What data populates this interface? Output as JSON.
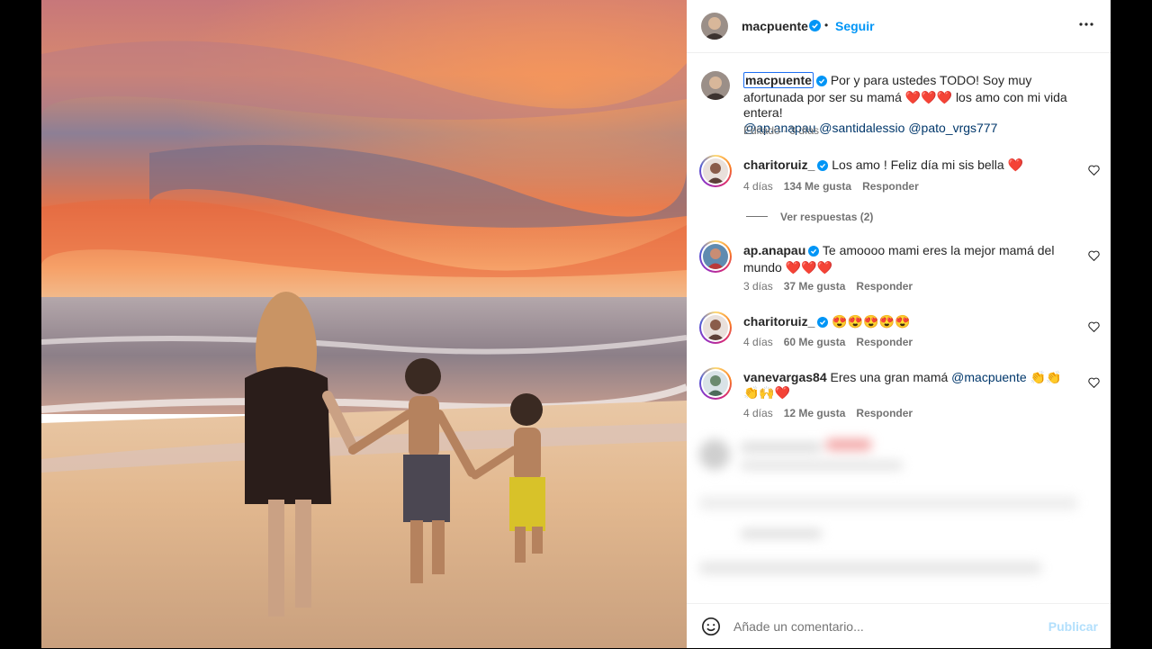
{
  "post": {
    "author": "macpuente",
    "follow_label": "Seguir",
    "dot": "•",
    "more_icon": "more-horizontal-icon"
  },
  "caption": {
    "author": "macpuente",
    "text": "Por y para ustedes TODO! Soy muy afortunada por ser su mamá ❤️❤️❤️ los amo con mi vida entera!",
    "mentions": "@ap.anapau @santidalessio @pato_vrgs777",
    "edited": "Editado · 3 días"
  },
  "comments": [
    {
      "user": "charitoruiz_",
      "verified": true,
      "text": "Los amo ! Feliz día mi sis bella ❤️",
      "time": "4 días",
      "likes": "134 Me gusta",
      "reply": "Responder"
    },
    {
      "user": "ap.anapau",
      "verified": true,
      "text": "Te amoooo mami eres la mejor mamá del mundo ❤️❤️❤️",
      "time": "3 días",
      "likes": "37 Me gusta",
      "reply": "Responder"
    },
    {
      "user": "charitoruiz_",
      "verified": true,
      "text": "😍😍😍😍😍",
      "time": "4 días",
      "likes": "60 Me gusta",
      "reply": "Responder"
    },
    {
      "user": "vanevargas84",
      "verified": false,
      "text": "Eres una gran mamá",
      "mention": "@macpuente",
      "emoji": "👏👏👏🙌❤️",
      "time": "4 días",
      "likes": "12 Me gusta",
      "reply": "Responder"
    }
  ],
  "replies_label": "Ver respuestas (2)",
  "footer": {
    "placeholder": "Añade un comentario...",
    "publish": "Publicar"
  },
  "colors": {
    "link": "#00376b",
    "accent": "#0095f6",
    "verified": "#0095f6",
    "background": "#000000"
  }
}
